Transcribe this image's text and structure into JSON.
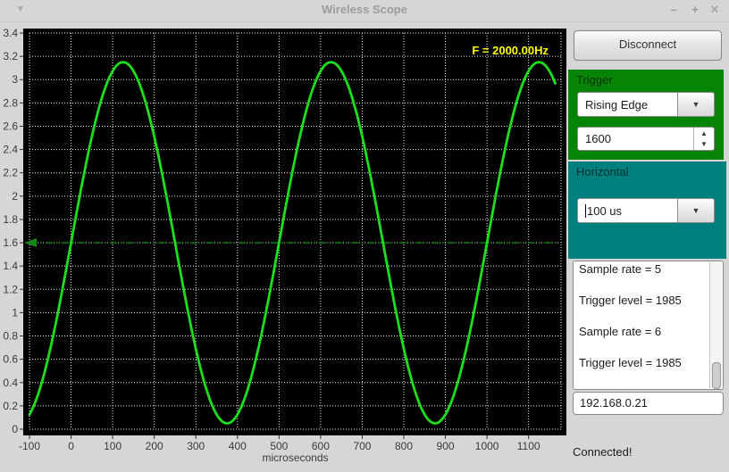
{
  "window": {
    "title": "Wireless Scope",
    "minimize_label": "–",
    "maximize_label": "+",
    "close_label": "✕"
  },
  "chart_data": {
    "type": "line",
    "title": "",
    "xlabel": "microseconds",
    "ylabel": "",
    "x_ticks": [
      -100,
      0,
      100,
      200,
      300,
      400,
      500,
      600,
      700,
      800,
      900,
      1000,
      1100
    ],
    "y_ticks": [
      0,
      0.2,
      0.4,
      0.6,
      0.8,
      1,
      1.2,
      1.4,
      1.6,
      1.8,
      2,
      2.2,
      2.4,
      2.6,
      2.8,
      3,
      3.2,
      3.4
    ],
    "xlim": [
      -100,
      1178
    ],
    "ylim": [
      0,
      3.4
    ],
    "grid": true,
    "background": "#000000",
    "grid_color": "#ffffff",
    "series": [
      {
        "name": "scope-trace",
        "shape": "sine",
        "amplitude": 1.55,
        "offset": 1.6,
        "period": 500,
        "zero_cross_rising_x": 0,
        "x_start": -100,
        "x_end": 1166,
        "color": "#1ddf1d",
        "peaks_x": [
          125,
          625,
          1125
        ],
        "peak_y": 3.15,
        "troughs_x": [
          375,
          875
        ],
        "trough_y": 0.05
      }
    ],
    "trigger_level": 1.6,
    "trigger_line_color": "#128a12",
    "frequency_label": "F = 2000.00Hz",
    "frequency_label_color": "#ffff00"
  },
  "sidebar": {
    "disconnect_button": "Disconnect",
    "trigger": {
      "title": "Trigger",
      "edge": "Rising Edge",
      "level": "1600",
      "panel_color": "#058405"
    },
    "horizontal": {
      "title": "Horizontal",
      "timebase": "100 us",
      "panel_color": "#007f7f"
    },
    "log_lines": [
      "Sample rate = 5",
      "Trigger level = 1985",
      "Sample rate = 6",
      "Trigger level = 1985"
    ],
    "ip_address": "192.168.0.21",
    "status": "Connected!"
  }
}
